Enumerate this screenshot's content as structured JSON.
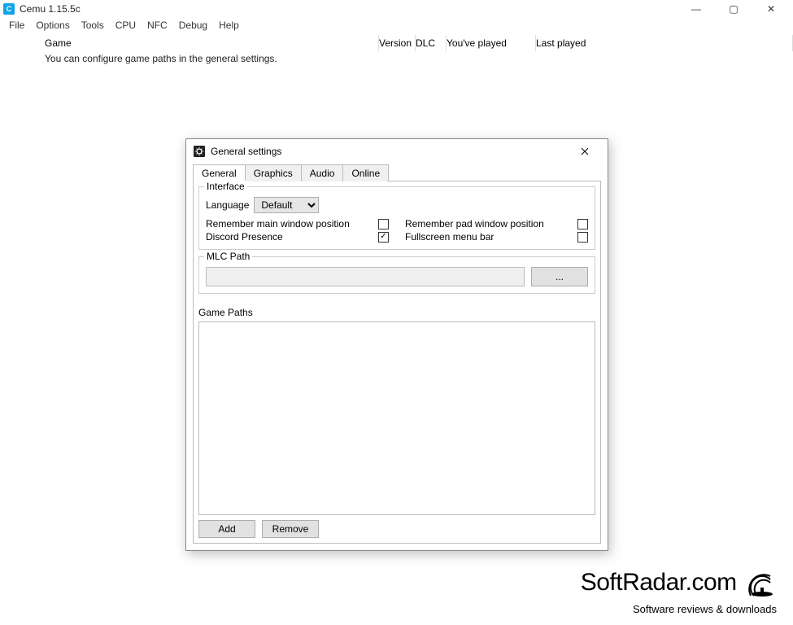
{
  "window": {
    "title": "Cemu 1.15.5c",
    "controls": {
      "min": "—",
      "max": "▢",
      "close": "✕"
    }
  },
  "menubar": [
    "File",
    "Options",
    "Tools",
    "CPU",
    "NFC",
    "Debug",
    "Help"
  ],
  "gamelist": {
    "headers": {
      "game": "Game",
      "version": "Version",
      "dlc": "DLC",
      "played": "You've played",
      "last": "Last played"
    },
    "hint": "You can configure game paths in the general settings."
  },
  "dialog": {
    "title": "General settings",
    "tabs": [
      "General",
      "Graphics",
      "Audio",
      "Online"
    ],
    "active_tab": 0,
    "interface": {
      "legend": "Interface",
      "language_label": "Language",
      "language_value": "Default",
      "remember_main": {
        "label": "Remember main window position",
        "checked": false
      },
      "remember_pad": {
        "label": "Remember pad window position",
        "checked": false
      },
      "discord": {
        "label": "Discord Presence",
        "checked": true
      },
      "fullscreen_menu": {
        "label": "Fullscreen menu bar",
        "checked": false
      }
    },
    "mlc": {
      "legend": "MLC Path",
      "value": "",
      "browse": "..."
    },
    "gamepaths": {
      "label": "Game Paths"
    },
    "buttons": {
      "add": "Add",
      "remove": "Remove"
    }
  },
  "watermark": {
    "line1": "SoftRadar.com",
    "line2": "Software reviews & downloads"
  }
}
